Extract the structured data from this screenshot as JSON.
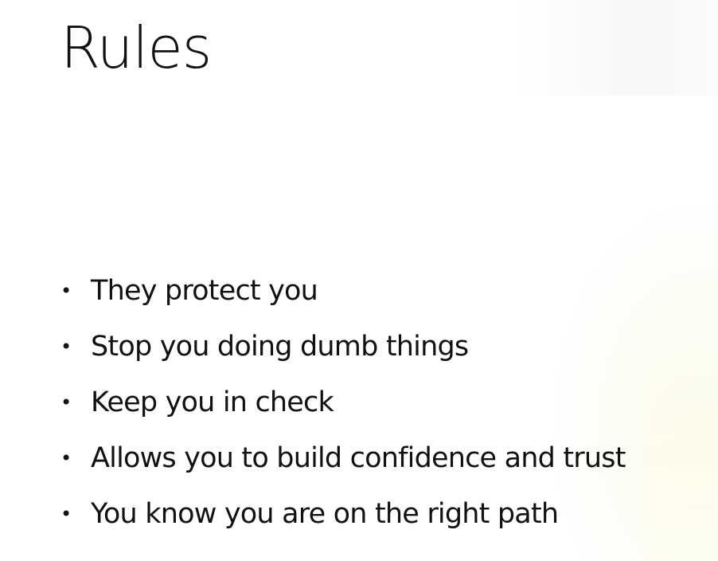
{
  "slide": {
    "title": "Rules",
    "bullets": [
      "They protect you",
      "Stop you doing dumb things",
      "Keep you in check",
      "Allows you to build confidence and trust",
      "You know you are on the right path"
    ],
    "bullet_glyph": "•"
  },
  "colors": {
    "background": "#ffffff",
    "text": "#111111"
  }
}
